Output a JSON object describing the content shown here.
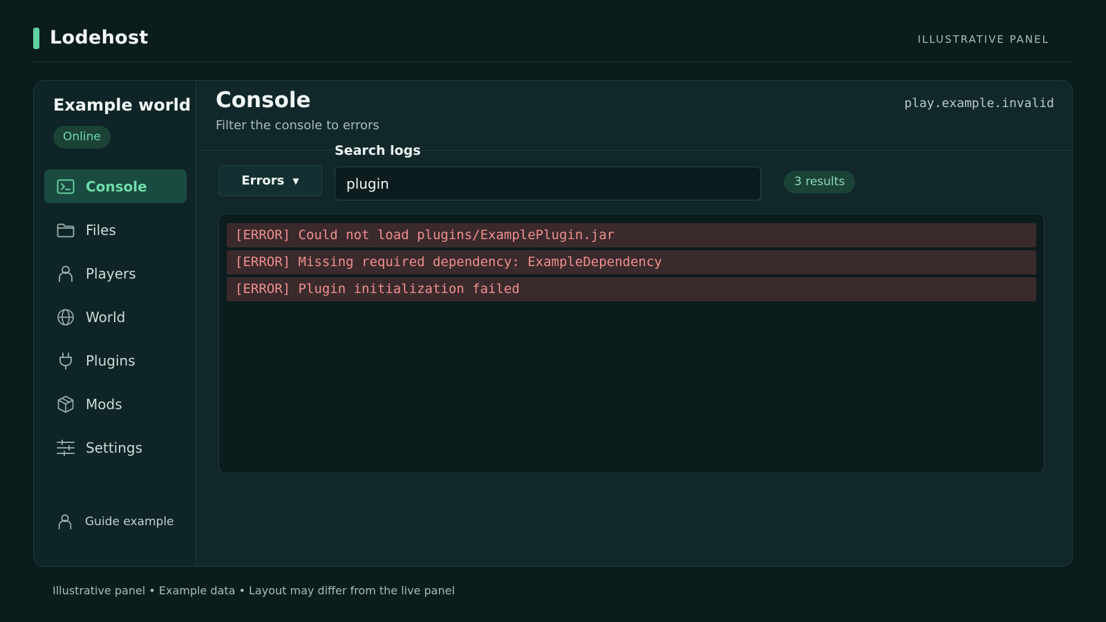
{
  "app": {
    "brand": "Lodehost",
    "tag": "ILLUSTRATIVE PANEL"
  },
  "server": {
    "name": "Example world",
    "status": "Online",
    "address": "play.example.invalid"
  },
  "sidebar": {
    "items": [
      {
        "label": "Console",
        "icon": "terminal-icon",
        "active": true
      },
      {
        "label": "Files",
        "icon": "folder-icon"
      },
      {
        "label": "Players",
        "icon": "user-icon"
      },
      {
        "label": "World",
        "icon": "globe-icon"
      },
      {
        "label": "Plugins",
        "icon": "plug-icon"
      },
      {
        "label": "Mods",
        "icon": "box-icon"
      },
      {
        "label": "Settings",
        "icon": "sliders-icon"
      }
    ],
    "user": {
      "label": "Guide example",
      "icon": "user-icon"
    }
  },
  "main": {
    "title": "Console",
    "subtitle": "Filter the console to errors",
    "filter": {
      "selected": "Errors"
    },
    "search": {
      "label": "Search logs",
      "value": "plugin"
    },
    "results": "3 results",
    "logs": [
      "[ERROR] Could not load plugins/ExamplePlugin.jar",
      "[ERROR] Missing required dependency: ExampleDependency",
      "[ERROR] Plugin initialization failed"
    ]
  },
  "footer": {
    "note": "Illustrative panel • Example data • Layout may differ from the live panel"
  },
  "colors": {
    "accent": "#5fd1a3",
    "background": "#0b1c1d",
    "error_text": "#ef8f8f",
    "error_bg": "#3b2a2c"
  }
}
